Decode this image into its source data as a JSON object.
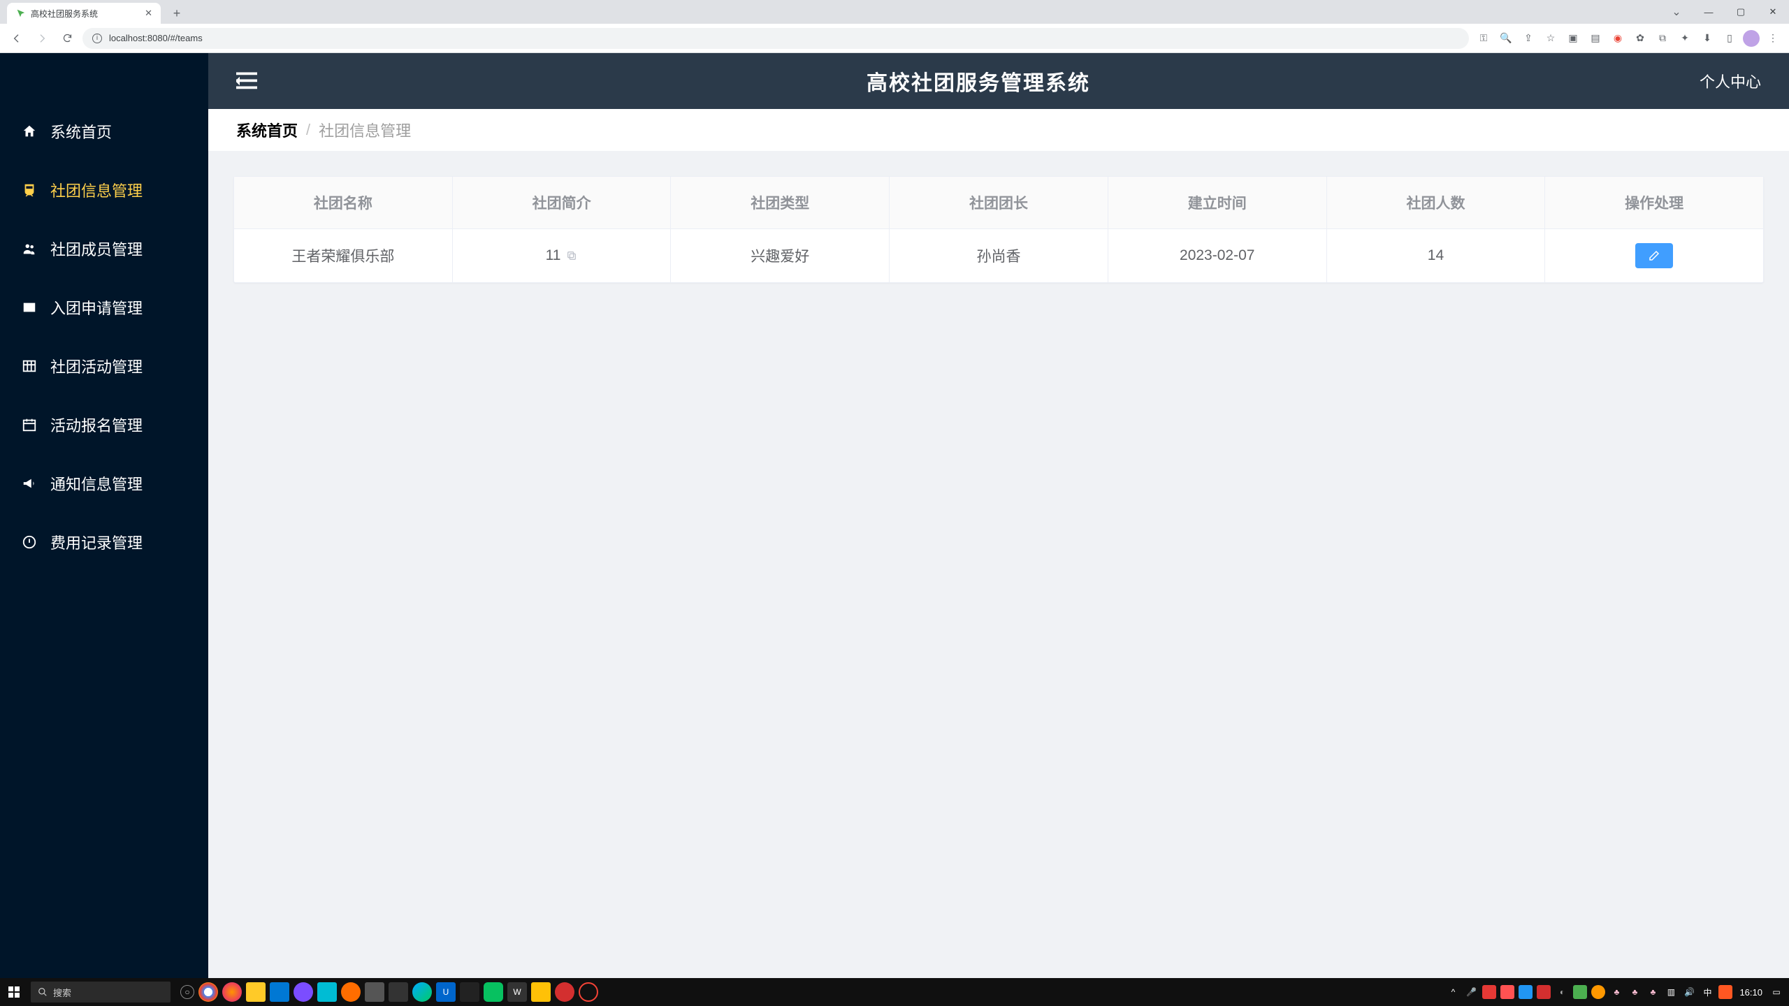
{
  "browser": {
    "tab_title": "高校社团服务系统",
    "url": "localhost:8080/#/teams"
  },
  "sidebar": {
    "items": [
      {
        "label": "系统首页",
        "icon": "home"
      },
      {
        "label": "社团信息管理",
        "icon": "train"
      },
      {
        "label": "社团成员管理",
        "icon": "users"
      },
      {
        "label": "入团申请管理",
        "icon": "envelope"
      },
      {
        "label": "社团活动管理",
        "icon": "table"
      },
      {
        "label": "活动报名管理",
        "icon": "calendar"
      },
      {
        "label": "通知信息管理",
        "icon": "bullhorn"
      },
      {
        "label": "费用记录管理",
        "icon": "power"
      }
    ],
    "active_index": 1
  },
  "header": {
    "title": "高校社团服务管理系统",
    "right": "个人中心"
  },
  "breadcrumb": {
    "root": "系统首页",
    "sep": "/",
    "current": "社团信息管理"
  },
  "table": {
    "columns": [
      "社团名称",
      "社团简介",
      "社团类型",
      "社团团长",
      "建立时间",
      "社团人数",
      "操作处理"
    ],
    "rows": [
      {
        "name": "王者荣耀俱乐部",
        "intro": "11",
        "type": "兴趣爱好",
        "leader": "孙尚香",
        "date": "2023-02-07",
        "count": "14"
      }
    ]
  },
  "taskbar": {
    "search_placeholder": "搜索",
    "clock": "16:10"
  }
}
